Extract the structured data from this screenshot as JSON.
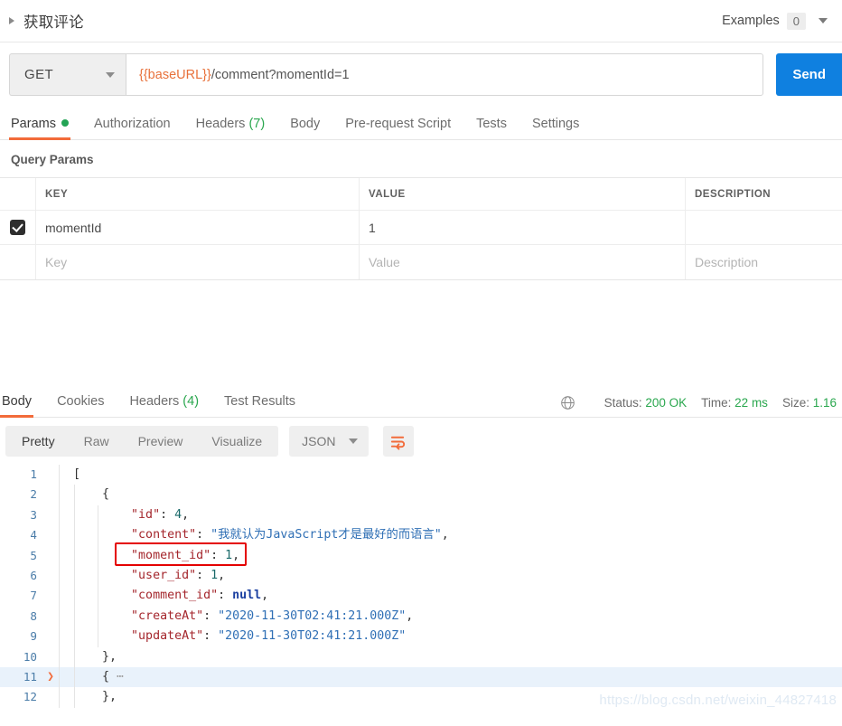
{
  "request_header": {
    "title": "获取评论",
    "examples_label": "Examples",
    "examples_count": "0"
  },
  "url_bar": {
    "method": "GET",
    "url_variable": "{{baseURL}}",
    "url_rest": "/comment?momentId=1",
    "send_label": "Send"
  },
  "request_tabs": [
    {
      "label": "Params",
      "badge": "",
      "dot": true,
      "active": true
    },
    {
      "label": "Authorization",
      "badge": "",
      "dot": false,
      "active": false
    },
    {
      "label": "Headers",
      "badge": "(7)",
      "dot": false,
      "active": false
    },
    {
      "label": "Body",
      "badge": "",
      "dot": false,
      "active": false
    },
    {
      "label": "Pre-request Script",
      "badge": "",
      "dot": false,
      "active": false
    },
    {
      "label": "Tests",
      "badge": "",
      "dot": false,
      "active": false
    },
    {
      "label": "Settings",
      "badge": "",
      "dot": false,
      "active": false
    }
  ],
  "query_params": {
    "section_title": "Query Params",
    "columns": [
      "KEY",
      "VALUE",
      "DESCRIPTION"
    ],
    "rows": [
      {
        "checked": true,
        "key": "momentId",
        "value": "1",
        "description": ""
      }
    ],
    "placeholder_row": {
      "key": "Key",
      "value": "Value",
      "description": "Description"
    }
  },
  "response_tabs": [
    {
      "label": "Body",
      "badge": "",
      "active": true
    },
    {
      "label": "Cookies",
      "badge": "",
      "active": false
    },
    {
      "label": "Headers",
      "badge": "(4)",
      "active": false
    },
    {
      "label": "Test Results",
      "badge": "",
      "active": false
    }
  ],
  "response_meta": {
    "status_label": "Status:",
    "status_value": "200 OK",
    "time_label": "Time:",
    "time_value": "22 ms",
    "size_label": "Size:",
    "size_value": "1.16"
  },
  "viewer_toolbar": {
    "segments": [
      {
        "label": "Pretty",
        "active": true
      },
      {
        "label": "Raw",
        "active": false
      },
      {
        "label": "Preview",
        "active": false
      },
      {
        "label": "Visualize",
        "active": false
      }
    ],
    "format": "JSON"
  },
  "response_body": {
    "lines": [
      {
        "no": "1",
        "fold": "",
        "indent": 0,
        "selected": false,
        "tokens": [
          {
            "t": "brc",
            "v": "["
          }
        ]
      },
      {
        "no": "2",
        "fold": "",
        "indent": 1,
        "selected": false,
        "tokens": [
          {
            "t": "brc",
            "v": "{"
          }
        ]
      },
      {
        "no": "3",
        "fold": "",
        "indent": 2,
        "selected": false,
        "tokens": [
          {
            "t": "k",
            "v": "\"id\""
          },
          {
            "t": "p",
            "v": ": "
          },
          {
            "t": "n",
            "v": "4"
          },
          {
            "t": "p",
            "v": ","
          }
        ]
      },
      {
        "no": "4",
        "fold": "",
        "indent": 2,
        "selected": false,
        "tokens": [
          {
            "t": "k",
            "v": "\"content\""
          },
          {
            "t": "p",
            "v": ": "
          },
          {
            "t": "s",
            "v": "\"我就认为JavaScript才是最好的而语言\""
          },
          {
            "t": "p",
            "v": ","
          }
        ]
      },
      {
        "no": "5",
        "fold": "",
        "indent": 2,
        "selected": false,
        "tokens": [
          {
            "t": "k",
            "v": "\"moment_id\""
          },
          {
            "t": "p",
            "v": ": "
          },
          {
            "t": "n",
            "v": "1"
          },
          {
            "t": "p",
            "v": ","
          }
        ]
      },
      {
        "no": "6",
        "fold": "",
        "indent": 2,
        "selected": false,
        "tokens": [
          {
            "t": "k",
            "v": "\"user_id\""
          },
          {
            "t": "p",
            "v": ": "
          },
          {
            "t": "n",
            "v": "1"
          },
          {
            "t": "p",
            "v": ","
          }
        ]
      },
      {
        "no": "7",
        "fold": "",
        "indent": 2,
        "selected": false,
        "tokens": [
          {
            "t": "k",
            "v": "\"comment_id\""
          },
          {
            "t": "p",
            "v": ": "
          },
          {
            "t": "nul",
            "v": "null"
          },
          {
            "t": "p",
            "v": ","
          }
        ]
      },
      {
        "no": "8",
        "fold": "",
        "indent": 2,
        "selected": false,
        "tokens": [
          {
            "t": "k",
            "v": "\"createAt\""
          },
          {
            "t": "p",
            "v": ": "
          },
          {
            "t": "s",
            "v": "\"2020-11-30T02:41:21.000Z\""
          },
          {
            "t": "p",
            "v": ","
          }
        ]
      },
      {
        "no": "9",
        "fold": "",
        "indent": 2,
        "selected": false,
        "tokens": [
          {
            "t": "k",
            "v": "\"updateAt\""
          },
          {
            "t": "p",
            "v": ": "
          },
          {
            "t": "s",
            "v": "\"2020-11-30T02:41:21.000Z\""
          }
        ]
      },
      {
        "no": "10",
        "fold": "",
        "indent": 1,
        "selected": false,
        "tokens": [
          {
            "t": "brc",
            "v": "},"
          }
        ]
      },
      {
        "no": "11",
        "fold": "❯",
        "indent": 1,
        "selected": true,
        "tokens": [
          {
            "t": "brc",
            "v": "{"
          },
          {
            "t": "ellip",
            "v": " ⋯"
          }
        ]
      },
      {
        "no": "12",
        "fold": "",
        "indent": 1,
        "selected": false,
        "tokens": [
          {
            "t": "brc",
            "v": "},"
          }
        ]
      }
    ]
  },
  "annotation": {
    "highlight_target": "moment_id-line",
    "color": "#e40000"
  },
  "watermark": "https://blog.csdn.net/weixin_44827418"
}
